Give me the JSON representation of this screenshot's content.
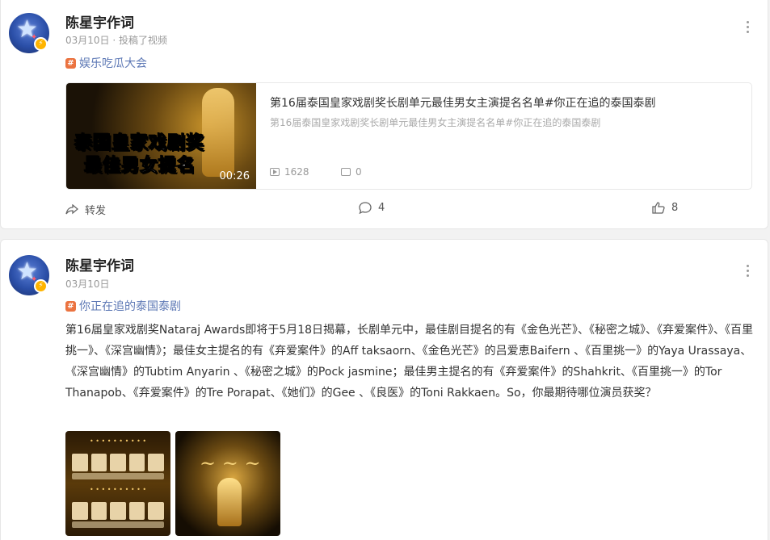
{
  "posts": [
    {
      "username": "陈星宇作词",
      "meta": "03月10日 · 投稿了视频",
      "topic": "娱乐吃瓜大会",
      "video": {
        "title": "第16届泰国皇家戏剧奖长剧单元最佳男女主演提名名单#你正在追的泰国泰剧",
        "desc": "第16届泰国皇家戏剧奖长剧单元最佳男女主演提名名单#你正在追的泰国泰剧",
        "thumb_caption_1": "泰国皇家戏剧奖",
        "thumb_caption_2": "最佳男女提名",
        "duration": "00:26",
        "plays": "1628",
        "danmaku": "0"
      },
      "actions": {
        "share": "转发",
        "comments": "4",
        "likes": "8"
      }
    },
    {
      "username": "陈星宇作词",
      "meta": "03月10日",
      "topic": "你正在追的泰国泰剧",
      "text": "第16届皇家戏剧奖Nataraj Awards即将于5月18日揭幕，长剧单元中，最佳剧目提名的有《金色光芒》、《秘密之城》、《弃爱案件》、《百里挑一》、《深宫幽情》；最佳女主提名的有《弃爱案件》的Aff taksaorn、《金色光芒》的吕爱恵Baifern 、《百里挑一》的Yaya Urassaya、《深宫幽情》的Tubtim Anyarin 、《秘密之城》的Pock jasmine；最佳男主提名的有《弃爱案件》的Shahkrit、《百里挑一》的Tor Thanapob、《弃爱案件》的Tre Porapat、《她们》的Gee 、《良医》的Toni Rakkaen。So，你最期待哪位演员获奖？"
    }
  ],
  "colors": {
    "topic_hash": "#eb7340",
    "topic_text": "#5d78b5",
    "badge": "#ffb400"
  }
}
